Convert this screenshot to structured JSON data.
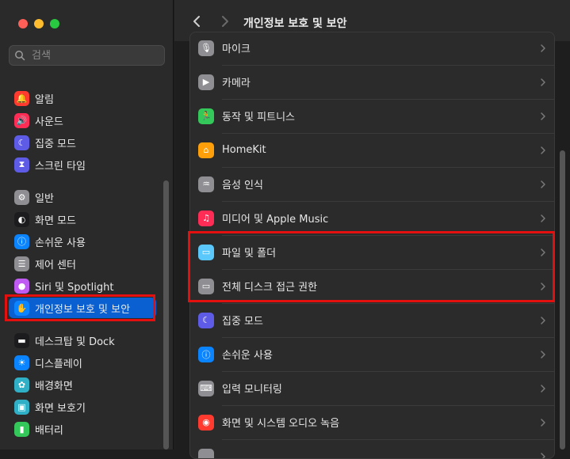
{
  "window": {
    "title": "개인정보 보호 및 보안"
  },
  "search": {
    "placeholder": "검색"
  },
  "sidebar": {
    "groups": [
      [
        {
          "label": "알림",
          "icon": "bell-icon",
          "color": "#ff3b30"
        },
        {
          "label": "사운드",
          "icon": "speaker-icon",
          "color": "#ff2d55"
        },
        {
          "label": "집중 모드",
          "icon": "moon-icon",
          "color": "#5e5ce6"
        },
        {
          "label": "스크린 타임",
          "icon": "hourglass-icon",
          "color": "#5e5ce6"
        }
      ],
      [
        {
          "label": "일반",
          "icon": "gear-icon",
          "color": "#8e8e93"
        },
        {
          "label": "화면 모드",
          "icon": "appearance-icon",
          "color": "#1c1c1e"
        },
        {
          "label": "손쉬운 사용",
          "icon": "accessibility-icon",
          "color": "#0a84ff"
        },
        {
          "label": "제어 센터",
          "icon": "control-center-icon",
          "color": "#8e8e93"
        },
        {
          "label": "Siri 및 Spotlight",
          "icon": "siri-icon",
          "color": "#bf5af2"
        },
        {
          "label": "개인정보 보호 및 보안",
          "icon": "hand-icon",
          "color": "#0a84ff",
          "selected": true
        }
      ],
      [
        {
          "label": "데스크탑 및 Dock",
          "icon": "dock-icon",
          "color": "#1c1c1e"
        },
        {
          "label": "디스플레이",
          "icon": "sun-icon",
          "color": "#0a84ff"
        },
        {
          "label": "배경화면",
          "icon": "flower-icon",
          "color": "#30b0c7"
        },
        {
          "label": "화면 보호기",
          "icon": "screensaver-icon",
          "color": "#30b0c7"
        },
        {
          "label": "배터리",
          "icon": "battery-icon",
          "color": "#34c759"
        }
      ]
    ]
  },
  "main": {
    "rows": [
      {
        "label": "마이크",
        "icon": "microphone-icon",
        "color": "#8e8e93"
      },
      {
        "label": "카메라",
        "icon": "camera-icon",
        "color": "#8e8e93"
      },
      {
        "label": "동작 및 피트니스",
        "icon": "fitness-icon",
        "color": "#34c759"
      },
      {
        "label": "HomeKit",
        "icon": "home-icon",
        "color": "#ff9f0a"
      },
      {
        "label": "음성 인식",
        "icon": "waveform-icon",
        "color": "#8e8e93"
      },
      {
        "label": "미디어 및 Apple Music",
        "icon": "music-icon",
        "color": "#ff2d55"
      },
      {
        "label": "파일 및 폴더",
        "icon": "folder-icon",
        "color": "#5ac8fa"
      },
      {
        "label": "전체 디스크 접근 권한",
        "icon": "disk-icon",
        "color": "#8e8e93"
      },
      {
        "label": "집중 모드",
        "icon": "moon-icon",
        "color": "#5e5ce6"
      },
      {
        "label": "손쉬운 사용",
        "icon": "accessibility-icon",
        "color": "#0a84ff"
      },
      {
        "label": "입력 모니터링",
        "icon": "keyboard-icon",
        "color": "#8e8e93"
      },
      {
        "label": "화면 및 시스템 오디오 녹음",
        "icon": "record-icon",
        "color": "#ff3b30"
      },
      {
        "label": "",
        "icon": "generic-icon",
        "color": "#8e8e93"
      }
    ]
  }
}
